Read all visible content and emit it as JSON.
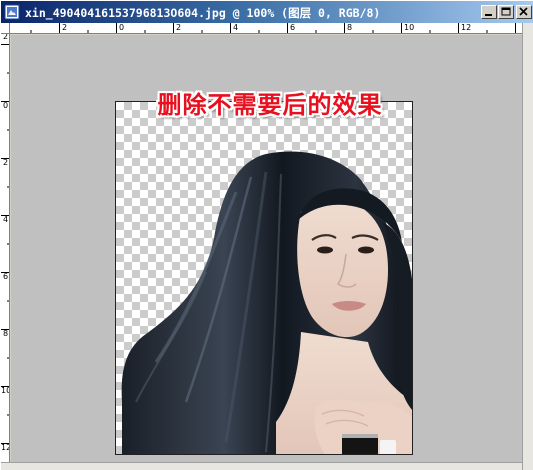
{
  "window": {
    "title": "xin_49040416153796813O604.jpg @ 100% (图层 0, RGB/8)",
    "buttons": {
      "minimize": "minimize",
      "maximize": "maximize",
      "close": "close"
    }
  },
  "rulers": {
    "horizontal": [
      "2",
      "0",
      "2",
      "4",
      "6",
      "8",
      "10",
      "12"
    ],
    "vertical": [
      "2",
      "0",
      "2",
      "4",
      "6",
      "8",
      "10",
      "12"
    ]
  },
  "canvas": {
    "zoom": "100%",
    "layer": "图层 0",
    "mode": "RGB/8",
    "caption": "删除不需要后的效果",
    "caption_color": "#e8101e",
    "transparency_pattern": "checkerboard"
  },
  "colors": {
    "title_start": "#0a246a",
    "title_end": "#a6caf0",
    "workspace": "#c0c0c0",
    "chrome": "#d4d0c8"
  }
}
